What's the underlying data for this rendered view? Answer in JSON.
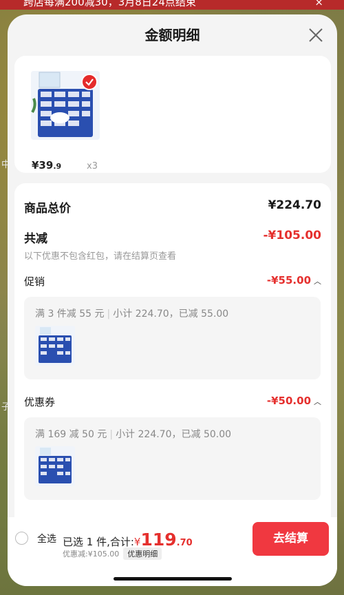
{
  "banner": {
    "text": "跨店每满200减30，3月8日24点结束",
    "close": "×"
  },
  "side_chars": [
    "中",
    "子"
  ],
  "sheet": {
    "title": "金额明细"
  },
  "product": {
    "price_int": "¥39",
    "price_dec": ".9",
    "qty": "x3"
  },
  "summary": {
    "total_label": "商品总价",
    "total_value": "¥224.70",
    "reduce_label": "共减",
    "reduce_value": "-¥105.00",
    "note": "以下优惠不包含红包，请在结算页查看"
  },
  "promotion": {
    "label": "促销",
    "value": "-¥55.00",
    "rule": "满 3 件减 55 元",
    "detail": "小计 224.70，已减 55.00"
  },
  "coupon": {
    "label": "优惠券",
    "value": "-¥50.00",
    "rule": "满 169 减 50 元",
    "detail": "小计 224.70，已减 50.00"
  },
  "footer": {
    "select_all": "全选",
    "selected": "已选 1 件,合计:",
    "currency": "¥",
    "amount_int": "119",
    "amount_dec": ".70",
    "discount": "优惠减:¥105.00",
    "detail_tag": "优惠明细",
    "checkout": "去结算"
  },
  "colors": {
    "accent": "#e5302e",
    "button": "#f03840"
  }
}
